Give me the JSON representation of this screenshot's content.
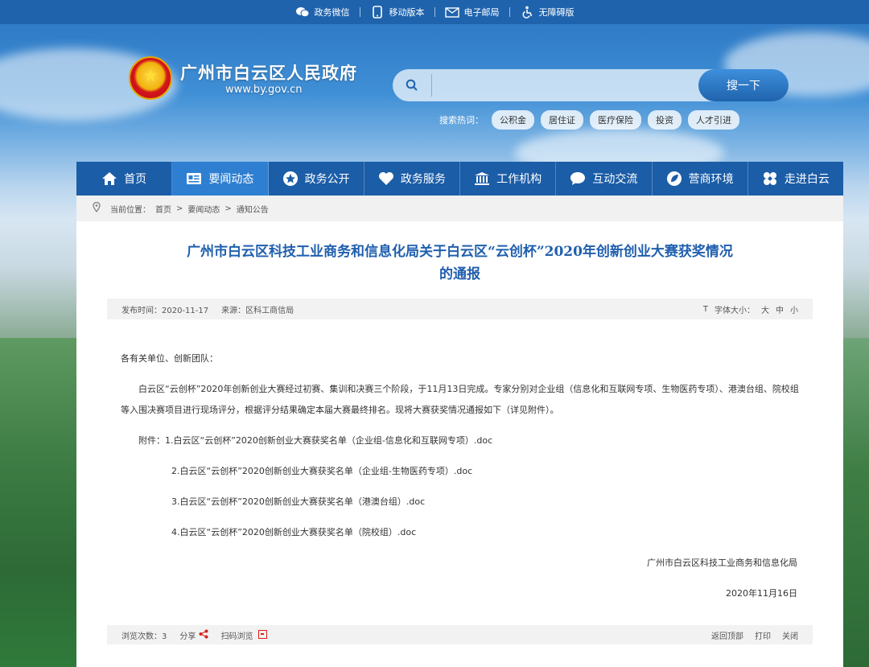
{
  "topbar": {
    "items": [
      {
        "label": "政务微信",
        "icon": "wechat-icon"
      },
      {
        "label": "移动版本",
        "icon": "mobile-icon"
      },
      {
        "label": "电子邮局",
        "icon": "mail-icon"
      },
      {
        "label": "无障碍版",
        "icon": "accessibility-icon"
      }
    ]
  },
  "header": {
    "title": "广州市白云区人民政府",
    "url": "www.by.gov.cn"
  },
  "search": {
    "placeholder": "",
    "button_label": "搜一下",
    "hot_label": "搜索热词：",
    "hot_tags": [
      "公积金",
      "居住证",
      "医疗保险",
      "投资",
      "人才引进"
    ]
  },
  "nav": {
    "items": [
      {
        "label": "首页",
        "icon": "home-icon"
      },
      {
        "label": "要闻动态",
        "icon": "news-icon",
        "active": true
      },
      {
        "label": "政务公开",
        "icon": "star-icon"
      },
      {
        "label": "政务服务",
        "icon": "heart-icon"
      },
      {
        "label": "工作机构",
        "icon": "building-icon"
      },
      {
        "label": "互动交流",
        "icon": "chat-icon"
      },
      {
        "label": "营商环境",
        "icon": "leaf-icon"
      },
      {
        "label": "走进白云",
        "icon": "flower-icon"
      }
    ]
  },
  "breadcrumb": {
    "prefix": "当前位置：",
    "path": [
      "首页",
      ">",
      "要闻动态",
      ">",
      "通知公告"
    ]
  },
  "article": {
    "title_line1": "广州市白云区科技工业商务和信息化局关于白云区“云创杯”2020年创新创业大赛获奖情况",
    "title_line2": "的通报",
    "publish_time": "发布时间：2020-11-17",
    "source": "来源：区科工商信局",
    "font_size_label": "字体大小：",
    "font_sizes": [
      "大",
      "中",
      "小"
    ],
    "salutation": "各有关单位、创新团队：",
    "paragraph": "白云区“云创杯”2020年创新创业大赛经过初赛、集训和决赛三个阶段，于11月13日完成。专家分别对企业组（信息化和互联网专项、生物医药专项）、港澳台组、院校组等入围决赛项目进行现场评分，根据评分结果确定本届大赛最终排名。现将大赛获奖情况通报如下（详见附件）。",
    "attachments_label": "附件：",
    "attachments": [
      "1.白云区“云创杯”2020创新创业大赛获奖名单（企业组-信息化和互联网专项）.doc",
      "2.白云区“云创杯”2020创新创业大赛获奖名单（企业组-生物医药专项）.doc",
      "3.白云区“云创杯”2020创新创业大赛获奖名单（港澳台组）.doc",
      "4.白云区“云创杯”2020创新创业大赛获奖名单（院校组）.doc"
    ],
    "signer": "广州市白云区科技工业商务和信息化局",
    "date": "2020年11月16日"
  },
  "footer": {
    "views_label": "浏览次数：3",
    "share_label": "分享",
    "qr_label": "扫码浏览",
    "back_top": "返回顶部",
    "print": "打印",
    "close": "关闭"
  },
  "colors": {
    "nav_bg": "#1b5da7",
    "nav_active": "#2e7fd1",
    "title": "#1f5fae",
    "accent_red": "#d9221c"
  }
}
